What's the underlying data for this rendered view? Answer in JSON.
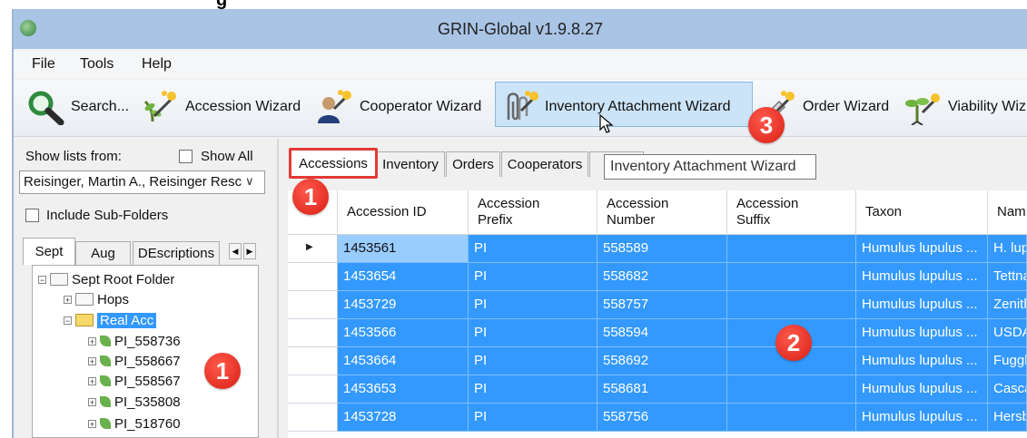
{
  "window": {
    "title": "GRIN-Global v1.9.8.27"
  },
  "menu": [
    "File",
    "Tools",
    "Help"
  ],
  "toolbar": {
    "search": "Search...",
    "accession_wizard": "Accession Wizard",
    "cooperator_wizard": "Cooperator Wizard",
    "inventory_attachment_wizard": "Inventory Attachment Wizard",
    "order_wizard": "Order Wizard",
    "viability_wizard": "Viability Wiz"
  },
  "left_panel": {
    "show_lists_from": "Show lists from:",
    "show_all": "Show All",
    "owner": "Reisinger, Martin A., Reisinger Resc",
    "include_sub_folders": "Include Sub-Folders",
    "tabs": [
      "Sept",
      "Aug",
      "DEscriptions"
    ],
    "tree": {
      "root": "Sept Root Folder",
      "hops": "Hops",
      "real_acc": "Real Acc",
      "items": [
        "PI_558736",
        "PI_558667",
        "PI_558567",
        "PI_535808",
        "PI_518760"
      ]
    }
  },
  "grid_tabs": [
    "Accessions",
    "Inventory",
    "Orders",
    "Cooperators"
  ],
  "tooltip": "Inventory Attachment Wizard",
  "grid": {
    "columns": [
      "Accession ID",
      "Accession\nPrefix",
      "Accession\nNumber",
      "Accession\nSuffix",
      "Taxon",
      "Nam"
    ],
    "rows": [
      [
        "1453561",
        "PI",
        "558589",
        "",
        "Humulus lupulus ...",
        "H. lup"
      ],
      [
        "1453654",
        "PI",
        "558682",
        "",
        "Humulus lupulus ...",
        "Tettna"
      ],
      [
        "1453729",
        "PI",
        "558757",
        "",
        "Humulus lupulus ...",
        "Zenith"
      ],
      [
        "1453566",
        "PI",
        "558594",
        "",
        "Humulus lupulus ...",
        "USDA"
      ],
      [
        "1453664",
        "PI",
        "558692",
        "",
        "Humulus lupulus ...",
        "Fuggl"
      ],
      [
        "1453653",
        "PI",
        "558681",
        "",
        "Humulus lupulus ...",
        "Casca"
      ],
      [
        "1453728",
        "PI",
        "558756",
        "",
        "Humulus lupulus ...",
        "Hersb"
      ]
    ]
  },
  "callouts": {
    "one": "1",
    "two": "2",
    "three": "3"
  }
}
